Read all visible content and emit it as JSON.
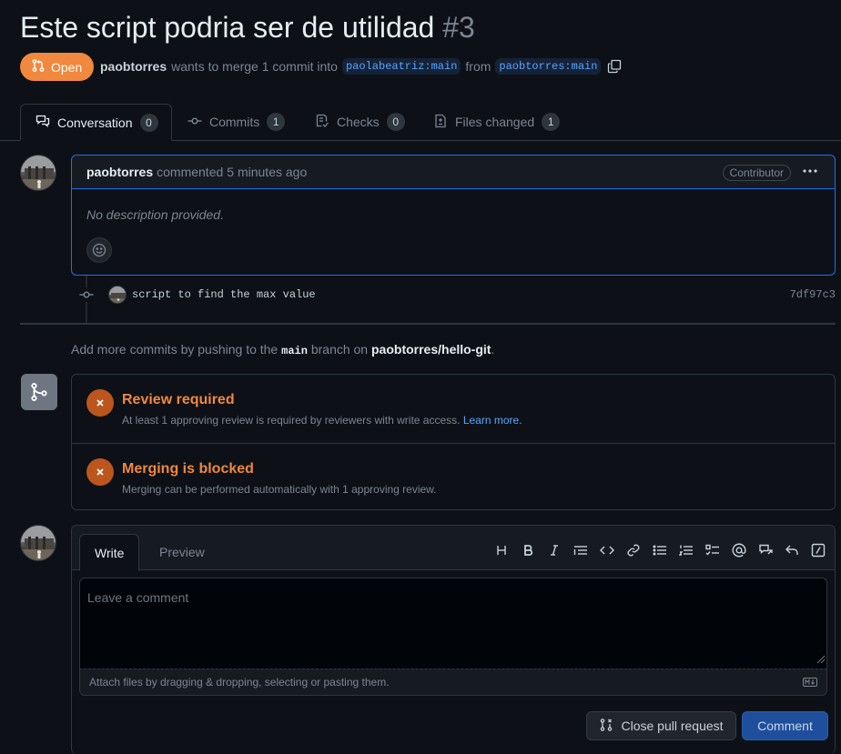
{
  "pr": {
    "title": "Este script podria ser de utilidad",
    "number": "#3",
    "state": "Open",
    "author": "paobtorres",
    "merge_text": "wants to merge 1 commit into",
    "base_branch": "paolabeatriz:main",
    "from_text": "from",
    "head_branch": "paobtorres:main"
  },
  "tabs": [
    {
      "label": "Conversation",
      "count": "0"
    },
    {
      "label": "Commits",
      "count": "1"
    },
    {
      "label": "Checks",
      "count": "0"
    },
    {
      "label": "Files changed",
      "count": "1"
    }
  ],
  "comment": {
    "author": "paobtorres",
    "action": "commented",
    "time": "5 minutes ago",
    "badge": "Contributor",
    "body": "No description provided."
  },
  "commit": {
    "message": "script to find the max value",
    "sha": "7df97c3"
  },
  "push_note": {
    "prefix": "Add more commits by pushing to the",
    "branch": "main",
    "middle": "branch on",
    "repo": "paobtorres/hello-git",
    "suffix": "."
  },
  "merge": {
    "review_title": "Review required",
    "review_desc": "At least 1 approving review is required by reviewers with write access.",
    "review_link": "Learn more.",
    "blocked_title": "Merging is blocked",
    "blocked_desc": "Merging can be performed automatically with 1 approving review."
  },
  "editor": {
    "write_tab": "Write",
    "preview_tab": "Preview",
    "placeholder": "Leave a comment",
    "attach_text": "Attach files by dragging & dropping, selecting or pasting them.",
    "close_button": "Close pull request",
    "comment_button": "Comment",
    "toolbar": [
      "heading-icon",
      "bold-icon",
      "italic-icon",
      "quote-icon",
      "code-icon",
      "link-icon",
      "bulleted-list-icon",
      "numbered-list-icon",
      "task-list-icon",
      "mention-icon",
      "cross-reference-icon",
      "reply-icon",
      "slash-command-icon"
    ]
  },
  "colors": {
    "open_badge": "#f0883e",
    "link": "#58a6ff",
    "warning": "#bd561d",
    "primary_button": "#1f4f9c"
  }
}
